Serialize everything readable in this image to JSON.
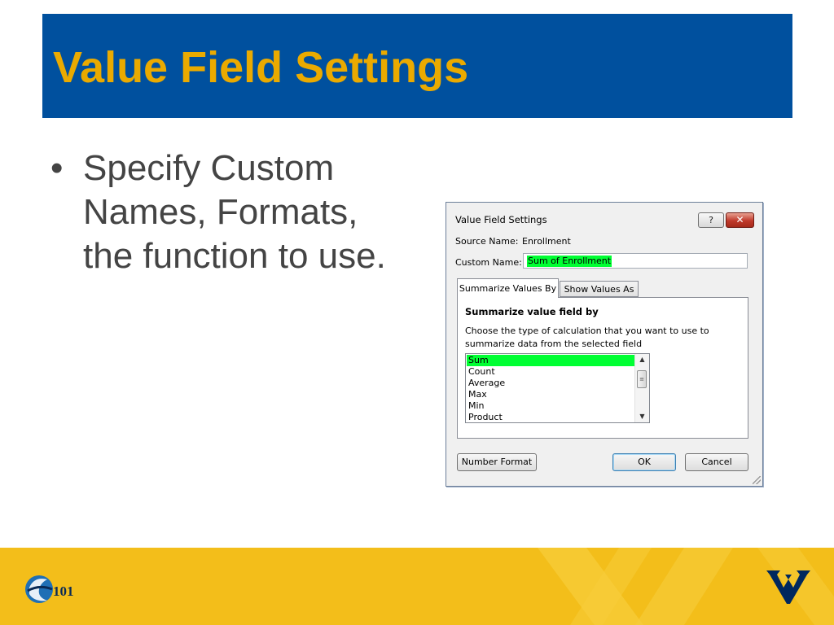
{
  "slide": {
    "title": "Value Field Settings",
    "bullet": "Specify Custom Names, Formats, the function to use."
  },
  "dialog": {
    "title": "Value Field Settings",
    "help_label": "?",
    "close_label": "✕",
    "source_name_label": "Source Name:",
    "source_name_value": "Enrollment",
    "custom_name_label": "Custom Name:",
    "custom_name_value": "Sum of Enrollment",
    "tabs": [
      {
        "label": "Summarize Values By",
        "active": true
      },
      {
        "label": "Show Values As",
        "active": false
      }
    ],
    "group_title": "Summarize value field by",
    "group_description": "Choose the type of calculation that you want to use to summarize data from the selected field",
    "functions": [
      "Sum",
      "Count",
      "Average",
      "Max",
      "Min",
      "Product"
    ],
    "selected_function": "Sum",
    "buttons": {
      "number_format": "Number Format",
      "ok": "OK",
      "cancel": "Cancel"
    }
  },
  "footer": {
    "logo_text": "101"
  },
  "colors": {
    "title_bar": "#00509e",
    "title_text": "#eaaa00",
    "footer": "#f3be1a",
    "highlight": "#00ff33"
  }
}
